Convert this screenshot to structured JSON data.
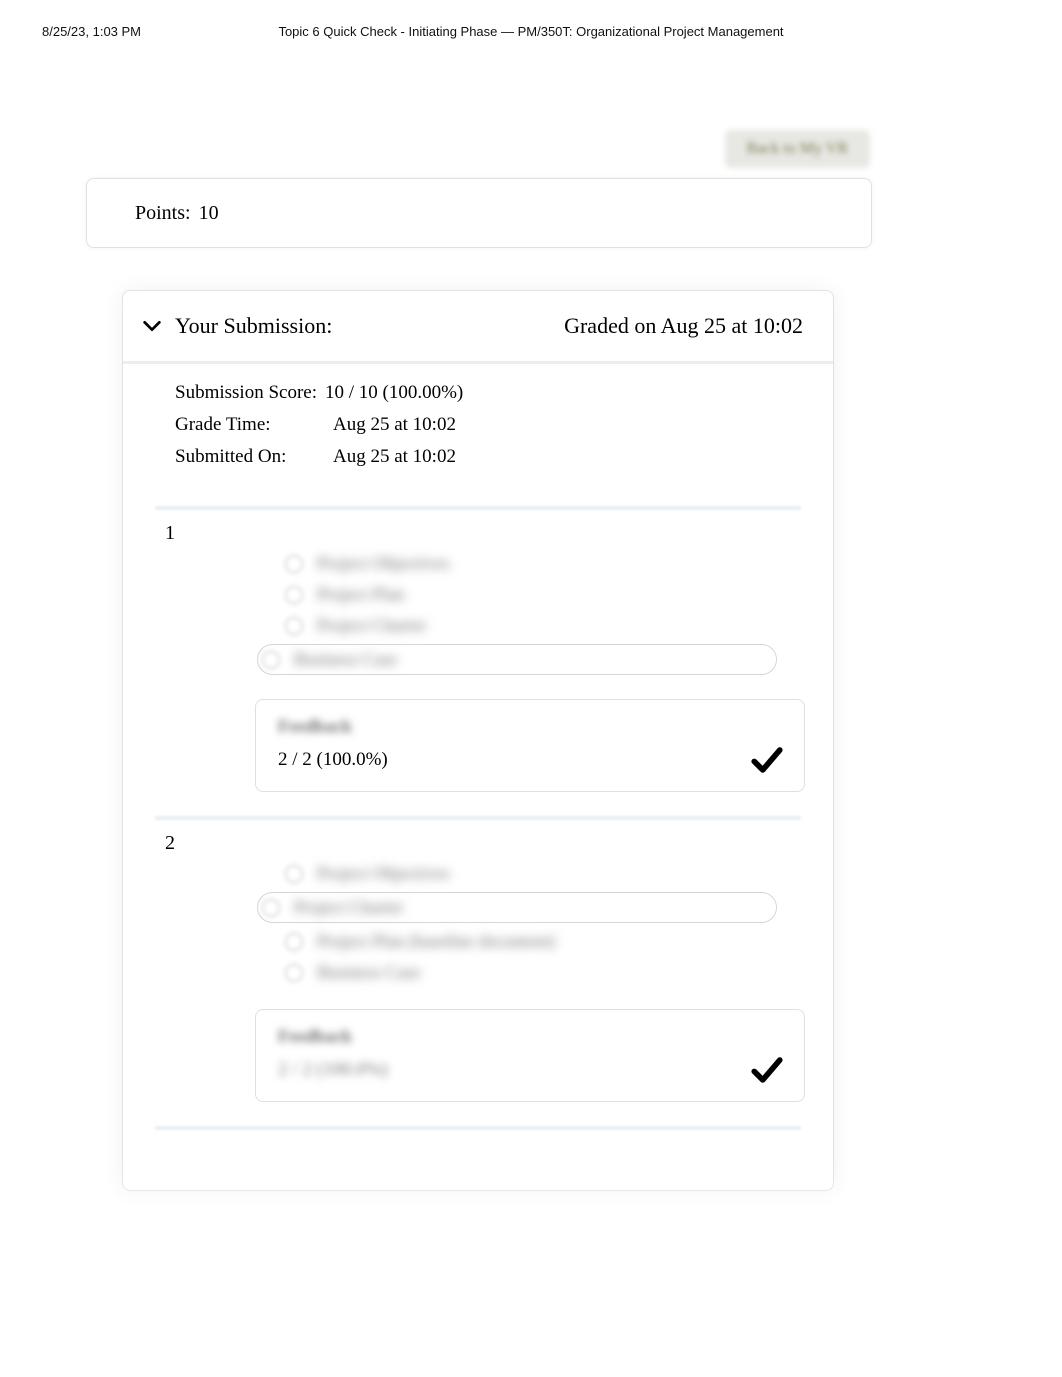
{
  "print": {
    "datetime": "8/25/23, 1:03 PM",
    "title": "Topic 6 Quick Check - Initiating Phase — PM/350T: Organizational Project Management"
  },
  "back_button": "Back to My VR",
  "points": {
    "label": "Points:",
    "value": "10"
  },
  "submission": {
    "header": "Your Submission:",
    "graded_on": "Graded on Aug 25 at 10:02",
    "score_label": "Submission Score:",
    "score_value": "10 / 10 (100.00%)",
    "grade_time_label": "Grade Time:",
    "grade_time_value": "Aug 25 at 10:02",
    "submitted_label": "Submitted On:",
    "submitted_value": "Aug 25 at 10:02"
  },
  "questions": [
    {
      "number": "1",
      "options": [
        {
          "label": "Project Objectives",
          "selected": false
        },
        {
          "label": "Project Plan",
          "selected": false
        },
        {
          "label": "Project Charter",
          "selected": false
        },
        {
          "label": "Business Case",
          "selected": true
        }
      ],
      "feedback_title": "Feedback",
      "feedback_score": "2 / 2 (100.0%)",
      "feedback_score_blurred": false
    },
    {
      "number": "2",
      "options": [
        {
          "label": "Project Objectives",
          "selected": false
        },
        {
          "label": "Project Charter",
          "selected": true
        },
        {
          "label": "Project Plan (baseline document)",
          "selected": false
        },
        {
          "label": "Business Case",
          "selected": false
        }
      ],
      "feedback_title": "Feedback",
      "feedback_score": "2 / 2 (100.0%)",
      "feedback_score_blurred": true
    }
  ]
}
